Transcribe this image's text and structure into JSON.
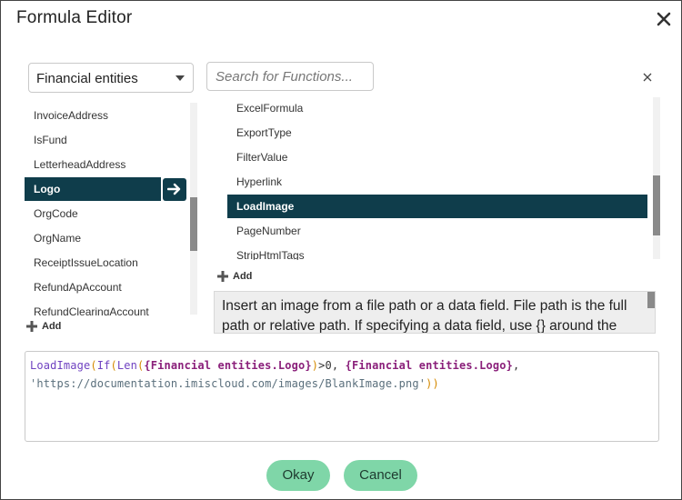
{
  "dialog": {
    "title": "Formula Editor"
  },
  "entity_select": {
    "selected": "Financial entities"
  },
  "search": {
    "placeholder": "Search for Functions..."
  },
  "fields": [
    {
      "label": "InvoiceAddress"
    },
    {
      "label": "IsFund"
    },
    {
      "label": "LetterheadAddress"
    },
    {
      "label": "Logo",
      "selected": true
    },
    {
      "label": "OrgCode"
    },
    {
      "label": "OrgName"
    },
    {
      "label": "ReceiptIssueLocation"
    },
    {
      "label": "RefundApAccount"
    },
    {
      "label": "RefundClearingAccount"
    }
  ],
  "functions": [
    {
      "label": "ExcelFormula"
    },
    {
      "label": "ExportType"
    },
    {
      "label": "FilterValue"
    },
    {
      "label": "Hyperlink"
    },
    {
      "label": "LoadImage",
      "selected": true
    },
    {
      "label": "PageNumber"
    },
    {
      "label": "StripHtmlTags"
    }
  ],
  "add_label": "Add",
  "description": "Insert an image from a file path or a data field. File path is the full path or relative path. If specifying a data field, use {} around the name.",
  "formula": {
    "line1": [
      {
        "t": "LoadImage",
        "c": "fn"
      },
      {
        "t": "(",
        "c": "paren"
      },
      {
        "t": "If",
        "c": "fn"
      },
      {
        "t": "(",
        "c": "paren"
      },
      {
        "t": "Len",
        "c": "fn"
      },
      {
        "t": "(",
        "c": "paren"
      },
      {
        "t": "{Financial entities.Logo}",
        "c": "ref"
      },
      {
        "t": ")",
        "c": "paren"
      },
      {
        "t": ">0, ",
        "c": "plain"
      },
      {
        "t": "{Financial entities.Logo}",
        "c": "ref"
      },
      {
        "t": ",",
        "c": "plain"
      }
    ],
    "line2": [
      {
        "t": "'https://documentation.imiscloud.com/images/BlankImage.png'",
        "c": "str"
      },
      {
        "t": ")",
        "c": "paren"
      },
      {
        "t": ")",
        "c": "paren"
      }
    ]
  },
  "buttons": {
    "ok": "Okay",
    "cancel": "Cancel"
  },
  "colors": {
    "accent": "#0f3d4b",
    "button": "#7fd6a8"
  }
}
